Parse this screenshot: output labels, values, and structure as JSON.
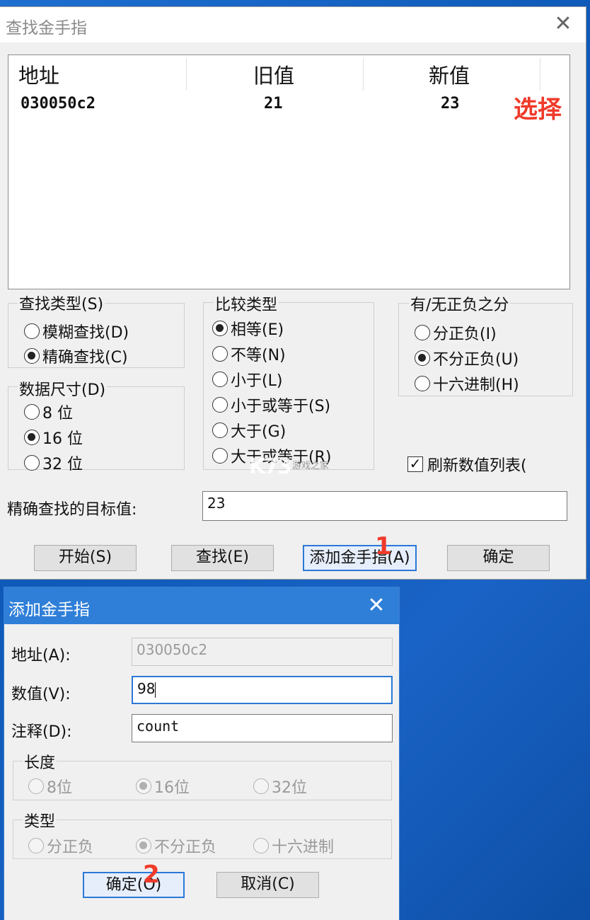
{
  "find_dialog": {
    "title": "查找金手指",
    "close_glyph": "✕",
    "columns": [
      "地址",
      "旧值",
      "新值"
    ],
    "rows": [
      {
        "address": "030050c2",
        "old": "21",
        "new": "23"
      }
    ],
    "select_note": "选择",
    "search_type": {
      "label": "查找类型(S)",
      "options": [
        "模糊查找(D)",
        "精确查找(C)"
      ],
      "selected": 1
    },
    "data_size": {
      "label": "数据尺寸(D)",
      "options": [
        "8 位",
        "16 位",
        "32 位"
      ],
      "selected": 1
    },
    "compare_type": {
      "label": "比较类型",
      "options": [
        "相等(E)",
        "不等(N)",
        "小于(L)",
        "小于或等于(S)",
        "大于(G)",
        "大于或等于(R)"
      ],
      "selected": 0
    },
    "sign": {
      "label": "有/无正负之分",
      "options": [
        "分正负(I)",
        "不分正负(U)",
        "十六进制(H)"
      ],
      "selected": 1
    },
    "refresh_label": "刷新数值列表(",
    "refresh_checked": true,
    "target_label": "精确查找的目标值:",
    "target_value": "23",
    "buttons": {
      "start": "开始(S)",
      "find": "查找(E)",
      "add": "添加金手指(A)",
      "ok": "确定"
    },
    "step_badge": "1",
    "watermark": "K73",
    "watermark_small": "游戏之家"
  },
  "add_dialog": {
    "title": "添加金手指",
    "close_glyph": "✕",
    "address_label": "地址(A):",
    "address_value": "030050c2",
    "value_label": "数值(V):",
    "value_value": "98",
    "comment_label": "注释(D):",
    "comment_value": "count",
    "length": {
      "label": "长度",
      "options": [
        "8位",
        "16位",
        "32位"
      ],
      "selected": 1
    },
    "type": {
      "label": "类型",
      "options": [
        "分正负",
        "不分正负",
        "十六进制"
      ],
      "selected": 1
    },
    "buttons": {
      "ok": "确定(O)",
      "cancel": "取消(C)"
    },
    "step_badge": "2"
  }
}
